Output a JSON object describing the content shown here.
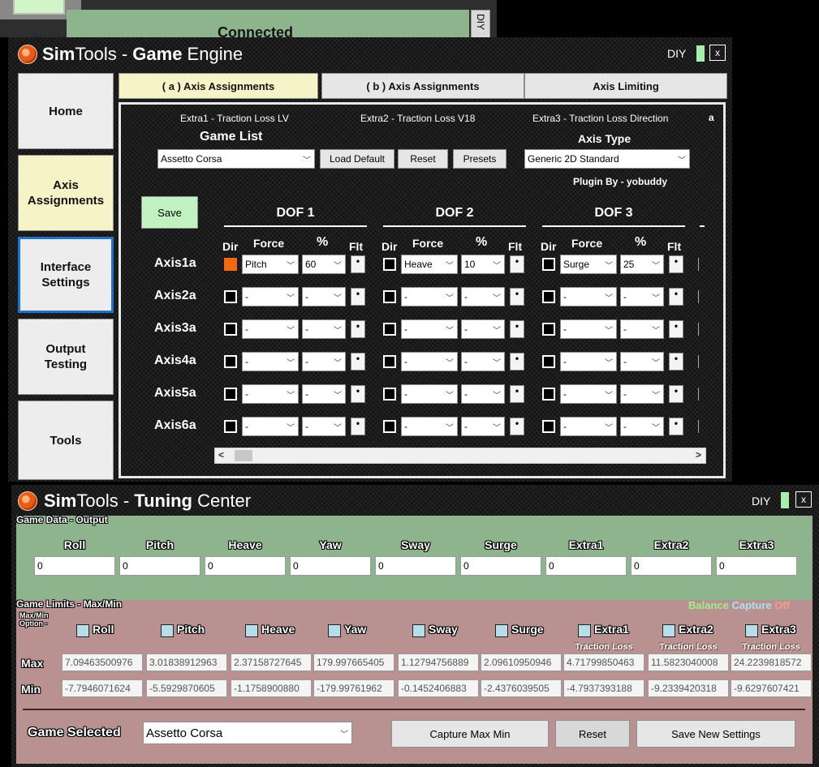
{
  "background_window": {
    "status_text": "Connected",
    "side_label": "DIY"
  },
  "game_engine": {
    "title_prefix": "Sim",
    "title_mid": "Tools - ",
    "title_bold": "Game",
    "title_suffix": " Engine",
    "diy_label": "DIY",
    "close_label": "x",
    "nav": [
      {
        "label": "Home"
      },
      {
        "label": "Axis\nAssignments"
      },
      {
        "label": "Interface\nSettings"
      },
      {
        "label": "Output\nTesting"
      },
      {
        "label": "Tools"
      }
    ],
    "tabs": [
      {
        "label": "( a ) Axis Assignments"
      },
      {
        "label": "( b ) Axis Assignments"
      },
      {
        "label": "Axis Limiting"
      }
    ],
    "extras": [
      "Extra1 - Traction Loss LV",
      "Extra2 - Traction Loss V18",
      "Extra3 - Traction Loss Direction"
    ],
    "extra_a": "a",
    "game_list_label": "Game List",
    "game_selected": "Assetto Corsa",
    "load_default_label": "Load Default",
    "reset_label": "Reset",
    "presets_label": "Presets",
    "axis_type_label": "Axis Type",
    "axis_type_value": "Generic 2D Standard",
    "plugin_by": "Plugin By - yobuddy",
    "save_label": "Save",
    "dof_headers": [
      "DOF 1",
      "DOF 2",
      "DOF 3"
    ],
    "col_headers": {
      "dir": "Dir",
      "force": "Force",
      "pct": "%",
      "flt": "Flt"
    },
    "axes": [
      {
        "label": "Axis1a",
        "cells": [
          {
            "dir_on": true,
            "force": "Pitch",
            "pct": "60"
          },
          {
            "dir_on": false,
            "force": "Heave",
            "pct": "10"
          },
          {
            "dir_on": false,
            "force": "Surge",
            "pct": "25"
          }
        ]
      },
      {
        "label": "Axis2a",
        "cells": [
          {
            "dir_on": false,
            "force": "-",
            "pct": "-"
          },
          {
            "dir_on": false,
            "force": "-",
            "pct": "-"
          },
          {
            "dir_on": false,
            "force": "-",
            "pct": "-"
          }
        ]
      },
      {
        "label": "Axis3a",
        "cells": [
          {
            "dir_on": false,
            "force": "-",
            "pct": "-"
          },
          {
            "dir_on": false,
            "force": "-",
            "pct": "-"
          },
          {
            "dir_on": false,
            "force": "-",
            "pct": "-"
          }
        ]
      },
      {
        "label": "Axis4a",
        "cells": [
          {
            "dir_on": false,
            "force": "-",
            "pct": "-"
          },
          {
            "dir_on": false,
            "force": "-",
            "pct": "-"
          },
          {
            "dir_on": false,
            "force": "-",
            "pct": "-"
          }
        ]
      },
      {
        "label": "Axis5a",
        "cells": [
          {
            "dir_on": false,
            "force": "-",
            "pct": "-"
          },
          {
            "dir_on": false,
            "force": "-",
            "pct": "-"
          },
          {
            "dir_on": false,
            "force": "-",
            "pct": "-"
          }
        ]
      },
      {
        "label": "Axis6a",
        "cells": [
          {
            "dir_on": false,
            "force": "-",
            "pct": "-"
          },
          {
            "dir_on": false,
            "force": "-",
            "pct": "-"
          },
          {
            "dir_on": false,
            "force": "-",
            "pct": "-"
          }
        ]
      }
    ],
    "flt_glyph": "•",
    "scroll_left": "<",
    "scroll_right": ">"
  },
  "tuning_center": {
    "title_prefix": "Sim",
    "title_mid": "Tools - ",
    "title_bold": "Tuning",
    "title_suffix": " Center",
    "diy_label": "DIY",
    "close_label": "x",
    "output_section_label": "Game Data - Output",
    "axes_names": [
      "Roll",
      "Pitch",
      "Heave",
      "Yaw",
      "Sway",
      "Surge",
      "Extra1",
      "Extra2",
      "Extra3"
    ],
    "output_values": [
      "0",
      "0",
      "0",
      "0",
      "0",
      "0",
      "0",
      "0",
      "0"
    ],
    "limits_section_label": "Game Limits - Max/Min",
    "balance_label": "Balance",
    "capture_label": "Capture",
    "off_label": "Off",
    "option_label_1": "Max/Min",
    "option_label_2": "Option -",
    "traction_loss_label": "Traction Loss",
    "max_label": "Max",
    "min_label": "Min",
    "max_values": [
      "7.09463500976",
      "3.01838912963",
      "2.37158727645",
      "179.997665405",
      "1.12794756889",
      "2.09610950946",
      "4.71799850463",
      "11.5823040008",
      "24.2239818572"
    ],
    "min_values": [
      "-7.7946071624",
      "-5.5929870605",
      "-1.1758900880",
      "-179.99761962",
      "-0.1452406883",
      "-2.4376039505",
      "-4.7937393188",
      "-9.2339420318",
      "-9.6297607421"
    ],
    "game_selected_label": "Game Selected",
    "game_selected_value": "Assetto Corsa",
    "capture_max_min_label": "Capture Max Min",
    "reset_label": "Reset",
    "save_new_settings_label": "Save New Settings"
  },
  "colors": {
    "accent_orange": "#f06a13",
    "panel_green": "#8db48c",
    "panel_red": "#b89190",
    "nav_active": "#f5f3c7",
    "focus_blue": "#1f74c7"
  }
}
